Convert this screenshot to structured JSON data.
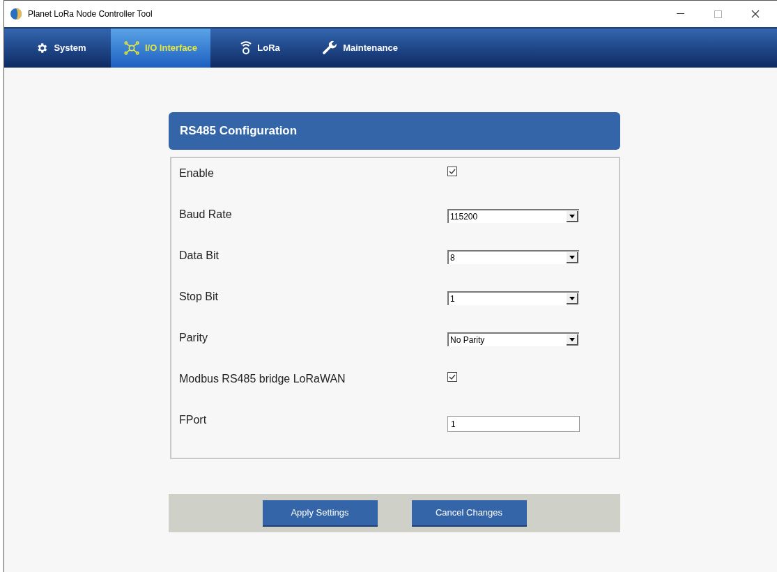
{
  "window": {
    "title": "Planet LoRa Node Controller Tool"
  },
  "tabs": [
    {
      "label": "System",
      "selected": false
    },
    {
      "label": "I/O Interface",
      "selected": true
    },
    {
      "label": "LoRa",
      "selected": false
    },
    {
      "label": "Maintenance",
      "selected": false
    }
  ],
  "panel": {
    "title": "RS485 Configuration"
  },
  "fields": [
    {
      "kind": "checkbox",
      "label": "Enable",
      "checked": true
    },
    {
      "kind": "select",
      "label": "Baud Rate",
      "value": "115200"
    },
    {
      "kind": "select",
      "label": "Data Bit",
      "value": "8"
    },
    {
      "kind": "select",
      "label": "Stop Bit",
      "value": "1"
    },
    {
      "kind": "select",
      "label": "Parity",
      "value": "No Parity"
    },
    {
      "kind": "checkbox",
      "label": "Modbus RS485 bridge LoRaWAN",
      "checked": true
    },
    {
      "kind": "text",
      "label": "FPort",
      "value": "1"
    }
  ],
  "buttons": [
    "Apply Settings",
    "Cancel Changes"
  ]
}
